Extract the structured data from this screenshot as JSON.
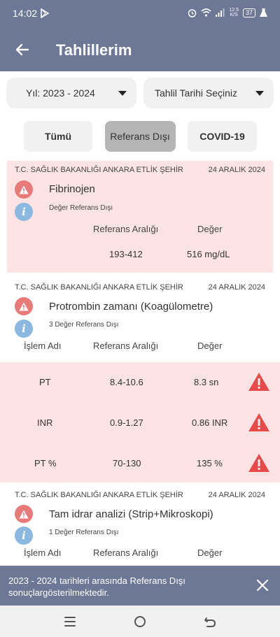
{
  "status": {
    "time": "14:02",
    "net_speed_top": "12.5",
    "net_speed_bottom": "K/S",
    "battery": "37"
  },
  "header": {
    "title": "Tahlillerim"
  },
  "filters": {
    "year": "Yıl: 2023 - 2024",
    "date": "Tahlil Tarihi Seçiniz"
  },
  "tabs": {
    "all": "Tümü",
    "out_of_range": "Referans Dışı",
    "covid": "COVID-19"
  },
  "cards": [
    {
      "hospital": "T.C. SAĞLIK BAKANLIĞI ANKARA ETLİK ŞEHİR",
      "date": "24 ARALIK 2024",
      "test": "Fibrinojen",
      "sub": "Değer Referans Dışı",
      "col_ref": "Referans Aralığı",
      "col_val": "Değer",
      "ref": "193-412",
      "value": "516 mg/dL"
    },
    {
      "hospital": "T.C. SAĞLIK BAKANLIĞI ANKARA ETLİK ŞEHİR",
      "date": "24 ARALIK 2024",
      "test": "Protrombin zamanı (Koagülometre)",
      "sub": "3 Değer Referans Dışı",
      "col_name": "İşlem Adı",
      "col_ref": "Referans Aralığı",
      "col_val": "Değer",
      "rows": [
        {
          "name": "PT",
          "ref": "8.4-10.6",
          "value": "8.3 sn"
        },
        {
          "name": "INR",
          "ref": "0.9-1.27",
          "value": "0.86 INR"
        },
        {
          "name": "PT %",
          "ref": "70-130",
          "value": "135 %"
        }
      ]
    },
    {
      "hospital": "T.C. SAĞLIK BAKANLIĞI ANKARA ETLİK ŞEHİR",
      "date": "24 ARALIK 2024",
      "test": "Tam idrar analizi (Strip+Mikroskopi)",
      "sub": "1 Değer Referans Dışı",
      "col_name": "İşlem Adı",
      "col_ref": "Referans Aralığı",
      "col_val": "Değer"
    }
  ],
  "snackbar": {
    "message": "2023 - 2024 tarihleri arasında Referans Dışı sonuçlargösterilmektedir."
  },
  "colors": {
    "primary": "#6d7896",
    "alert_bg": "#fde3e3",
    "alert_red": "#e84a4a",
    "info_blue": "#8bb8e0"
  }
}
